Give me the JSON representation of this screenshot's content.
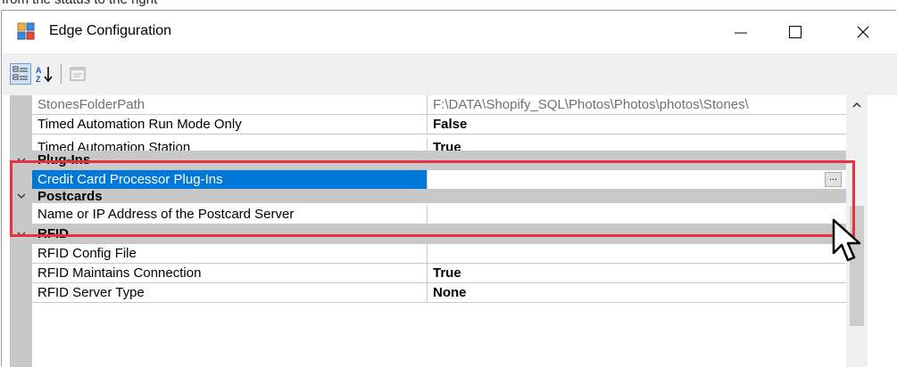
{
  "top_snippet": "from the status to the right",
  "window": {
    "title": "Edge Configuration"
  },
  "toolbar": {
    "categorized_tooltip": "Categorized",
    "alphabetical_tooltip": "Alphabetical",
    "property_pages_tooltip": "Property Pages"
  },
  "grid": {
    "rows": [
      {
        "kind": "prop",
        "name": "StonesFolderPath",
        "value": "F:\\DATA\\Shopify_SQL\\Photos\\Photos\\photos\\Stones\\",
        "disabled": true
      },
      {
        "kind": "prop",
        "name": "Timed Automation Run Mode Only",
        "value": "False"
      },
      {
        "kind": "prop",
        "name": "Timed Automation Station",
        "value": "True"
      },
      {
        "kind": "cat",
        "name": "Plug-Ins"
      },
      {
        "kind": "prop",
        "name": "Credit Card Processor Plug-Ins",
        "value": "",
        "selected": true,
        "ellipsis": "..."
      },
      {
        "kind": "cat",
        "name": "Postcards"
      },
      {
        "kind": "prop",
        "name": "Name or IP Address of the Postcard Server",
        "value": ""
      },
      {
        "kind": "cat",
        "name": "RFID"
      },
      {
        "kind": "prop",
        "name": "RFID Config File",
        "value": ""
      },
      {
        "kind": "prop",
        "name": "RFID Maintains Connection",
        "value": "True"
      },
      {
        "kind": "prop",
        "name": "RFID Server Type",
        "value": "None"
      }
    ]
  },
  "colors": {
    "selection": "#0078d7",
    "highlight_box": "#e8313f",
    "category_band": "#c8c8c8"
  }
}
